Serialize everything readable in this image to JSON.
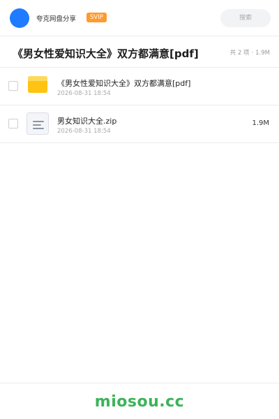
{
  "header": {
    "app_name": "夸克网盘分享",
    "badge": "SVIP",
    "search_placeholder": "搜索"
  },
  "share": {
    "title": "《男女性爱知识大全》双方都满意[pdf]",
    "count": "共 2 项",
    "total_size": "1.9M"
  },
  "files": [
    {
      "name": "《男女性爱知识大全》双方都满意[pdf]",
      "date": "2026-08-31 18:54",
      "size": "",
      "icon": "folder-icon"
    },
    {
      "name": "男女知识大全.zip",
      "date": "2026-08-31 18:54",
      "size": "1.9M",
      "icon": "document-icon"
    }
  ],
  "footer": {
    "watermark": "miosou.cc"
  },
  "colors": {
    "accent": "#1f7bff",
    "badge": "#ff9a2e",
    "folder": "#ffc312",
    "watermark": "#3cb35a"
  }
}
